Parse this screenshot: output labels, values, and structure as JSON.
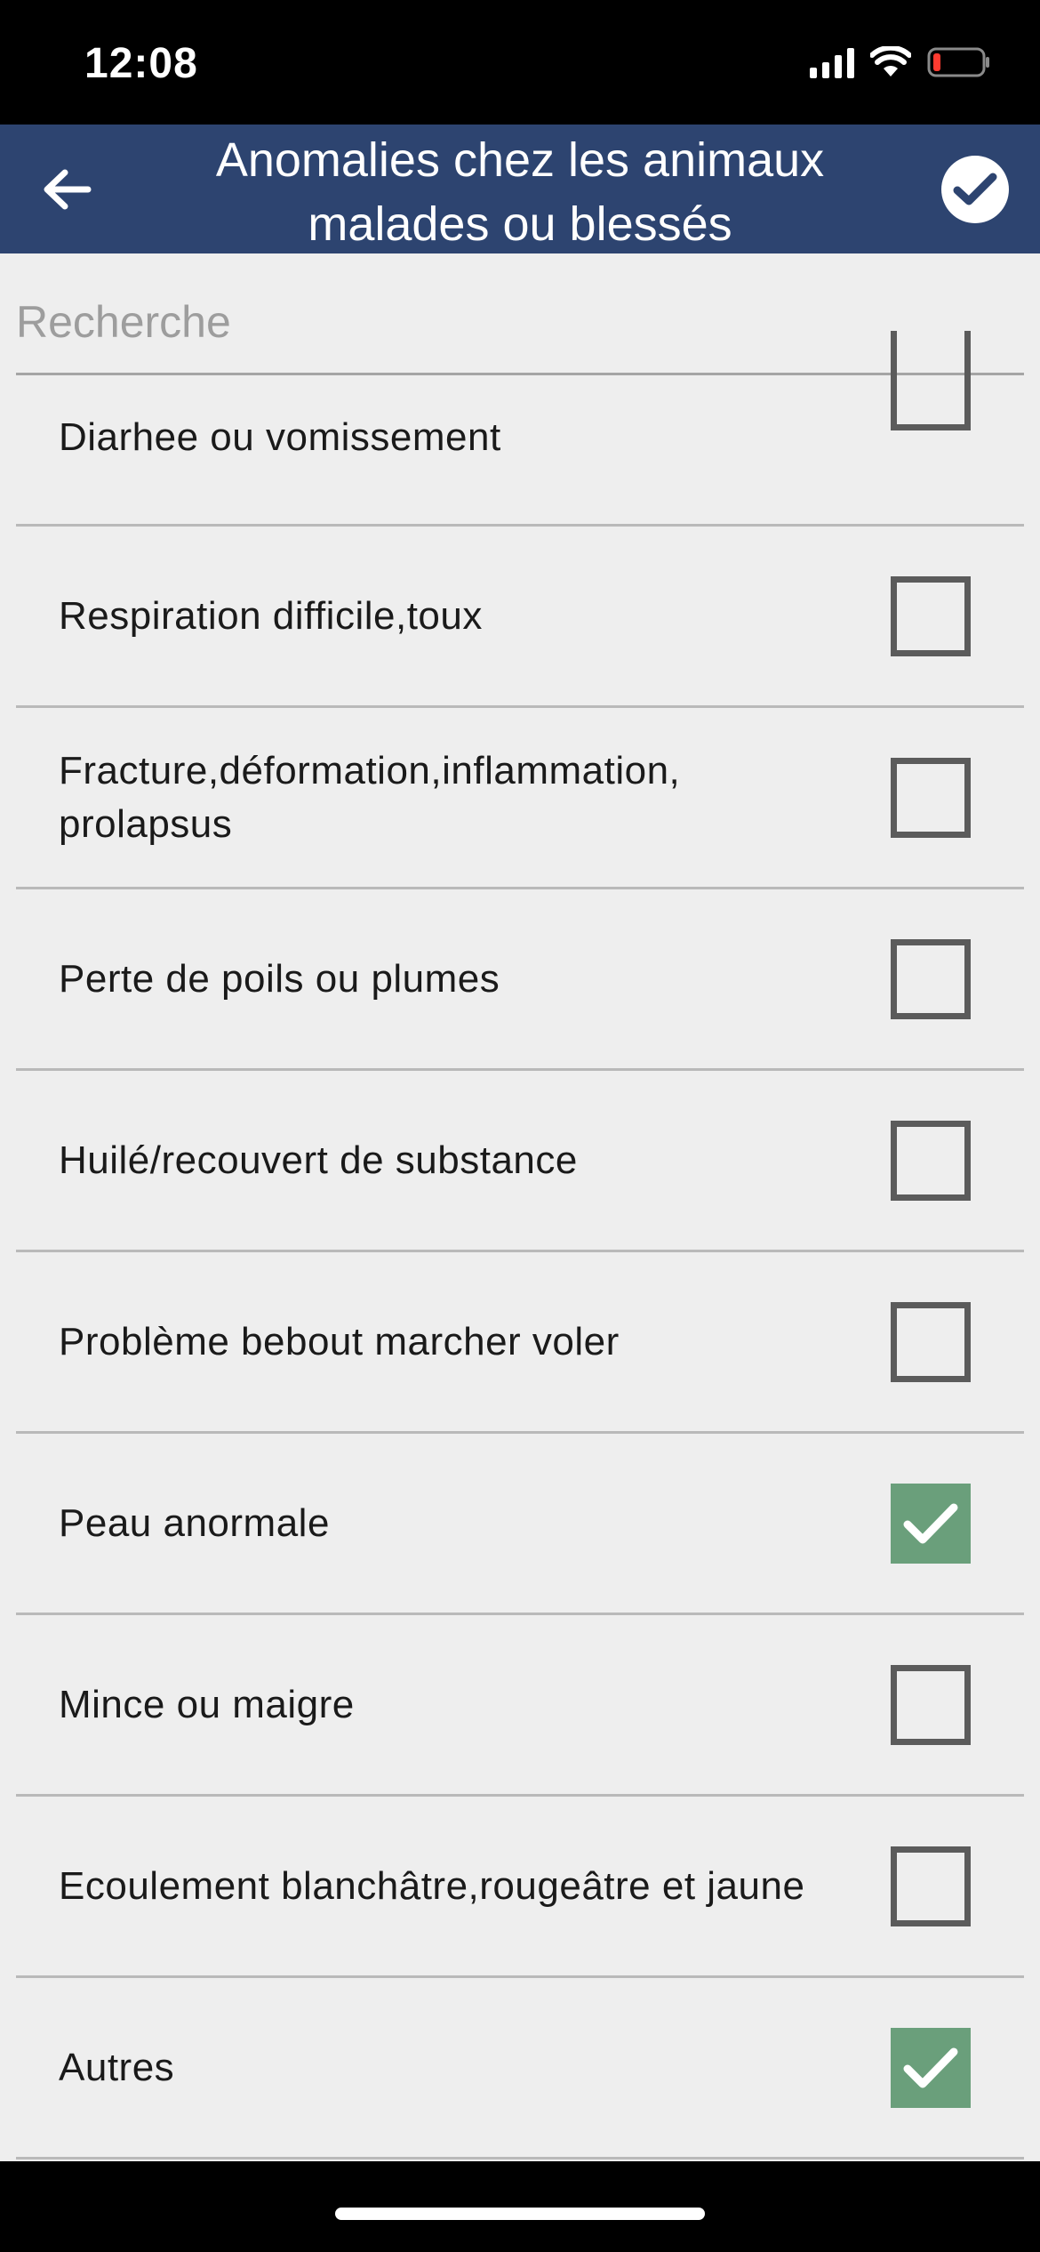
{
  "status_bar": {
    "time": "12:08"
  },
  "header": {
    "title": "Anomalies chez les animaux malades ou blessés"
  },
  "search": {
    "placeholder": "Recherche",
    "value": ""
  },
  "items": [
    {
      "label": "Diarhee ou vomissement",
      "checked": false
    },
    {
      "label": "Respiration difficile,toux",
      "checked": false
    },
    {
      "label": "Fracture,déformation,inflammation, prolapsus",
      "checked": false
    },
    {
      "label": "Perte de poils ou plumes",
      "checked": false
    },
    {
      "label": "Huilé/recouvert de substance",
      "checked": false
    },
    {
      "label": "Problème bebout marcher voler",
      "checked": false
    },
    {
      "label": "Peau anormale",
      "checked": true
    },
    {
      "label": "Mince ou maigre",
      "checked": false
    },
    {
      "label": "Ecoulement blanchâtre,rougeâtre et jaune",
      "checked": false
    },
    {
      "label": "Autres",
      "checked": true
    }
  ],
  "colors": {
    "header_bg": "#2d4470",
    "checked_bg": "#6a9f7b",
    "content_bg": "#eeeeee"
  }
}
